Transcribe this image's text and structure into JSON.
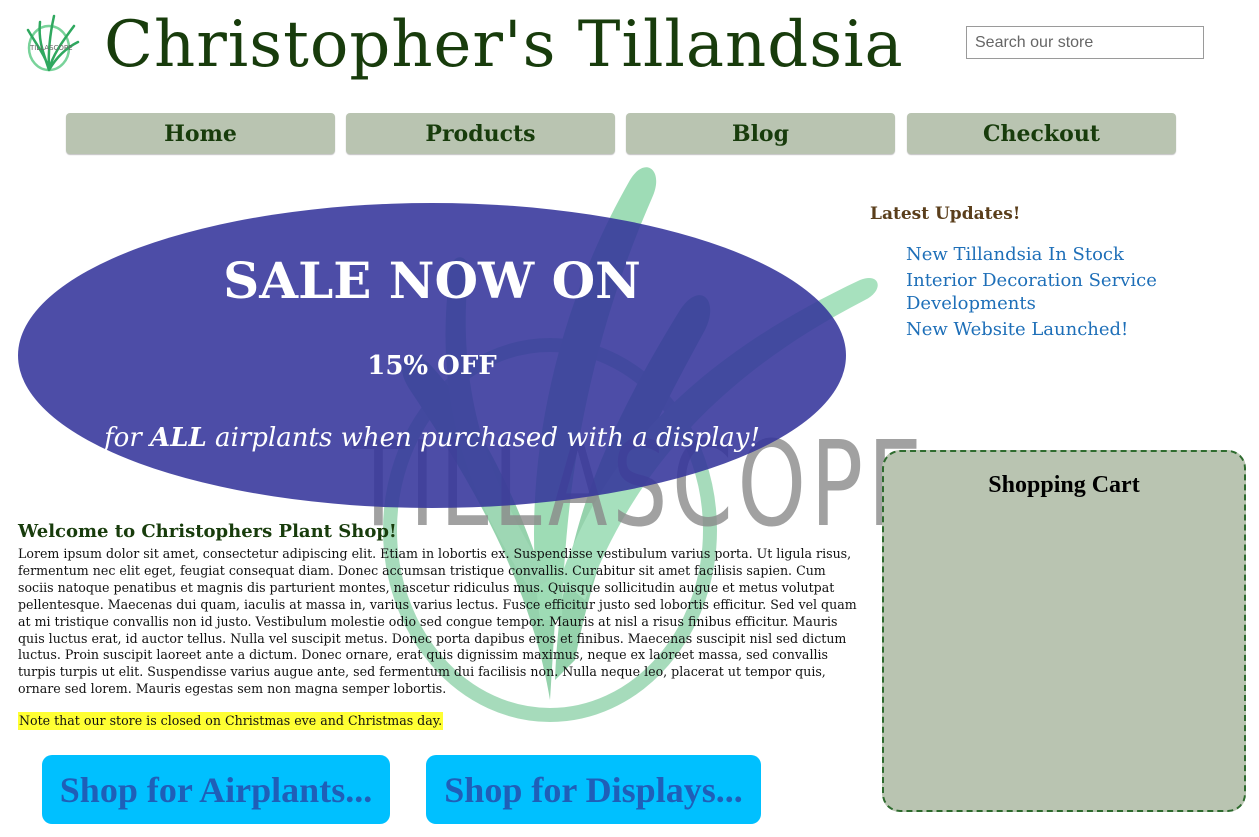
{
  "header": {
    "title": "Christopher's Tillandsia",
    "logo_icon": "airplant-logo-icon"
  },
  "search": {
    "placeholder": "Search our store"
  },
  "nav": {
    "items": [
      {
        "label": "Home"
      },
      {
        "label": "Products"
      },
      {
        "label": "Blog"
      },
      {
        "label": "Checkout"
      }
    ]
  },
  "sale": {
    "headline": "SALE NOW ON",
    "discount": "15% OFF",
    "tagline_prefix": "for ",
    "tagline_emphasis": "ALL",
    "tagline_suffix": " airplants when purchased with a display!"
  },
  "updates": {
    "title": "Latest Updates!",
    "items": [
      {
        "label": "New Tillandsia In Stock"
      },
      {
        "label": "Interior Decoration Service Developments"
      },
      {
        "label": "New Website Launched!"
      }
    ]
  },
  "cart": {
    "title": "Shopping Cart"
  },
  "welcome": {
    "title": "Welcome to Christophers Plant Shop!",
    "body": "Lorem ipsum dolor sit amet, consectetur adipiscing elit. Etiam in lobortis ex. Suspendisse vestibulum varius porta. Ut ligula risus, fermentum nec elit eget, feugiat consequat diam. Donec accumsan tristique convallis. Curabitur sit amet facilisis sapien. Cum sociis natoque penatibus et magnis dis parturient montes, nascetur ridiculus mus. Quisque sollicitudin augue et metus volutpat pellentesque. Maecenas dui quam, iaculis at massa in, varius varius lectus. Fusce efficitur justo sed lobortis efficitur. Sed vel quam at mi tristique convallis non id justo. Vestibulum molestie odio sed congue tempor. Mauris at nisl a risus finibus efficitur. Mauris quis luctus erat, id auctor tellus. Nulla vel suscipit metus. Donec porta dapibus eros et finibus. Maecenas suscipit nisl sed dictum luctus. Proin suscipit laoreet ante a dictum. Donec ornare, erat quis dignissim maximus, neque ex laoreet massa, sed convallis turpis turpis ut elit. Suspendisse varius augue ante, sed fermentum dui facilisis non. Nulla neque leo, placerat ut tempor quis, ornare sed lorem. Mauris egestas sem non magna semper lobortis.",
    "note": "Note that our store is closed on Christmas eve and Christmas day."
  },
  "shop_buttons": {
    "airplants": "Shop for Airplants...",
    "displays": "Shop for Displays..."
  },
  "colors": {
    "title_green": "#183c0c",
    "nav_bg": "#b9c4b1",
    "sale_bg": "#34349b",
    "link_blue": "#1e6fb8",
    "shop_button_bg": "#00c0ff",
    "note_highlight": "#ffff33"
  },
  "watermark": {
    "text": "TILLASCOPE",
    "icon": "tillascope-watermark-icon"
  }
}
